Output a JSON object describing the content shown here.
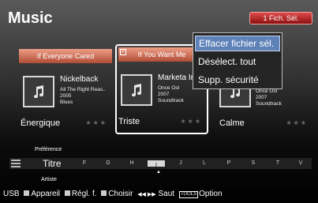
{
  "app": {
    "title": "Music",
    "selection_count_label": "1 Fich. Sél."
  },
  "cards": [
    {
      "heading": "If Everyone Cared",
      "artist": "Nickelback",
      "album": "All The Right Reas..",
      "year": "2005",
      "genre": "Blues",
      "mood": "Énergique",
      "stars": "★★★",
      "selected": false
    },
    {
      "heading": "If You Want Me",
      "artist": "Marketa Irg",
      "album": "Once Ost",
      "year": "2007",
      "genre": "Soundtrack",
      "mood": "Triste",
      "stars": "★★★",
      "selected": true,
      "check": "✓"
    },
    {
      "artist": "",
      "album": "Once Ost",
      "year": "2007",
      "genre": "Soundtrack",
      "mood": "Calme",
      "stars": "★★★",
      "selected": false
    }
  ],
  "context_menu": {
    "items": [
      {
        "label": "Effacer fichier sél.",
        "active": true
      },
      {
        "label": "Désélect. tout",
        "active": false
      },
      {
        "label": "Supp. sécurité",
        "active": false
      }
    ]
  },
  "sort_bar": {
    "preference_label": "Préférence",
    "current_category": "Titre",
    "artist_label": "Artiste",
    "cursor": "▲",
    "letters": [
      "F",
      "G",
      "H",
      "I",
      "J",
      "L",
      "P",
      "S",
      "T",
      "V"
    ],
    "highlighted_letter": "I"
  },
  "footer": {
    "source": "USB",
    "device": "Appareil",
    "settings": "Régl. f.",
    "choose": "Choisir",
    "jump_glyph": "◀◀ ▶▶",
    "jump": "Saut",
    "tools_badge": "TOOLS",
    "option": "Option"
  },
  "colors": {
    "card_header": "#c95b42",
    "menu_highlight": "#5e82b8",
    "selection_badge": "#b32121"
  }
}
